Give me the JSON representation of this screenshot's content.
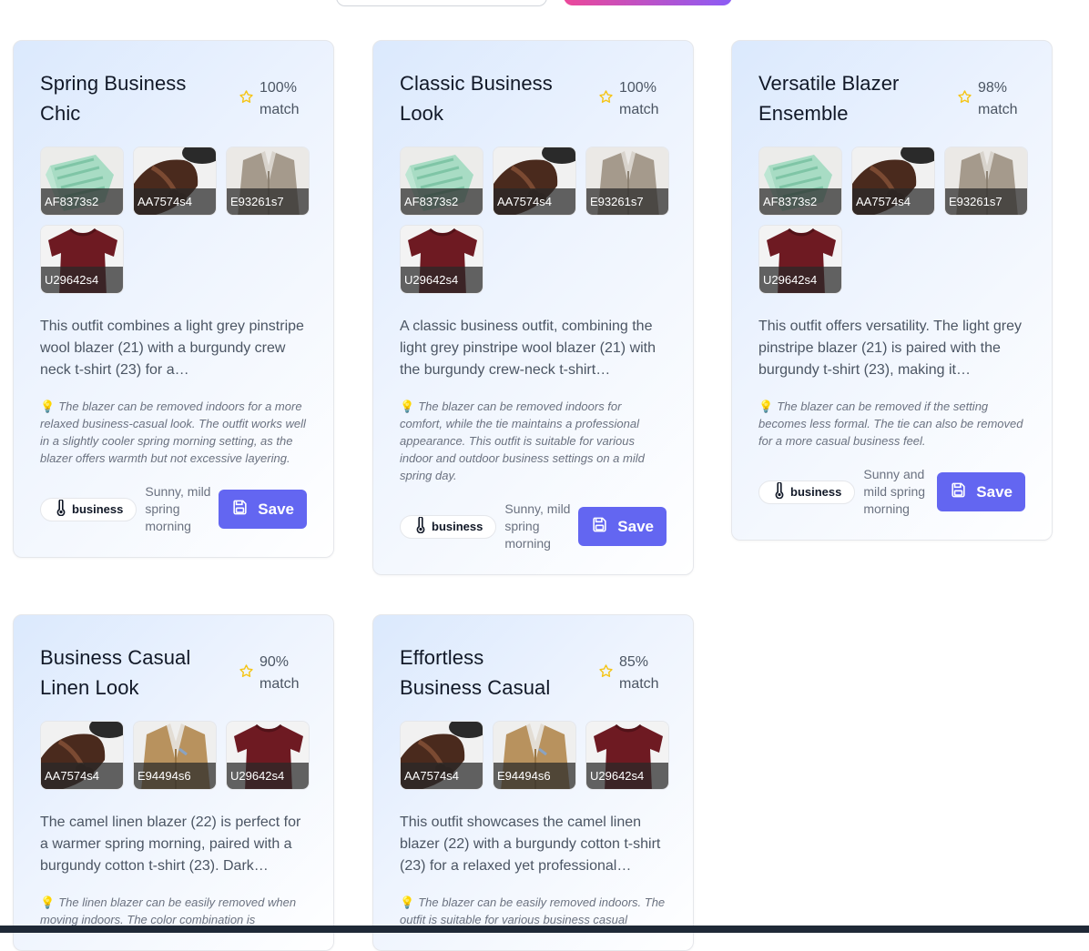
{
  "cards": [
    {
      "title": "Spring Business Chic",
      "match": "100% match",
      "items": [
        {
          "code": "AF8373s2",
          "kind": "green-shirt"
        },
        {
          "code": "AA7574s4",
          "kind": "brown-shoe"
        },
        {
          "code": "E93261s7",
          "kind": "grey-blazer"
        },
        {
          "code": "U29642s4",
          "kind": "burgundy-tshirt"
        }
      ],
      "description": "This outfit combines a light grey pinstripe wool blazer (21) with a burgundy crew neck t-shirt (23) for a…",
      "tip": "The blazer can be removed indoors for a more relaxed business-casual look. The outfit works well in a slightly cooler spring morning setting, as the blazer offers warmth but not excessive layering.",
      "tag": "business",
      "weather": "Sunny, mild spring morning",
      "save_label": "Save"
    },
    {
      "title": "Classic Business Look",
      "match": "100% match",
      "items": [
        {
          "code": "AF8373s2",
          "kind": "green-shirt"
        },
        {
          "code": "AA7574s4",
          "kind": "brown-shoe"
        },
        {
          "code": "E93261s7",
          "kind": "grey-blazer"
        },
        {
          "code": "U29642s4",
          "kind": "burgundy-tshirt"
        }
      ],
      "description": "A classic business outfit, combining the light grey pinstripe wool blazer (21) with the burgundy crew-neck t-shirt…",
      "tip": "The blazer can be removed indoors for comfort, while the tie maintains a professional appearance. This outfit is suitable for various indoor and outdoor business settings on a mild spring day.",
      "tag": "business",
      "weather": "Sunny, mild spring morning",
      "save_label": "Save"
    },
    {
      "title": "Versatile Blazer Ensemble",
      "match": "98% match",
      "items": [
        {
          "code": "AF8373s2",
          "kind": "green-shirt"
        },
        {
          "code": "AA7574s4",
          "kind": "brown-shoe"
        },
        {
          "code": "E93261s7",
          "kind": "grey-blazer"
        },
        {
          "code": "U29642s4",
          "kind": "burgundy-tshirt"
        }
      ],
      "description": "This outfit offers versatility. The light grey pinstripe blazer (21) is paired with the burgundy t-shirt (23), making it…",
      "tip": "The blazer can be removed if the setting becomes less formal. The tie can also be removed for a more casual business feel.",
      "tag": "business",
      "weather": "Sunny and mild spring morning",
      "save_label": "Save"
    },
    {
      "title": "Business Casual Linen Look",
      "match": "90% match",
      "items": [
        {
          "code": "AA7574s4",
          "kind": "brown-shoe"
        },
        {
          "code": "E94494s6",
          "kind": "camel-blazer"
        },
        {
          "code": "U29642s4",
          "kind": "burgundy-tshirt"
        }
      ],
      "description": "The camel linen blazer (22) is perfect for a warmer spring morning, paired with a burgundy cotton t-shirt (23). Dark…",
      "tip": "The linen blazer can be easily removed when moving indoors. The color combination is",
      "tag": "business",
      "weather": "",
      "save_label": "Save"
    },
    {
      "title": "Effortless Business Casual",
      "match": "85% match",
      "items": [
        {
          "code": "AA7574s4",
          "kind": "brown-shoe"
        },
        {
          "code": "E94494s6",
          "kind": "camel-blazer"
        },
        {
          "code": "U29642s4",
          "kind": "burgundy-tshirt"
        }
      ],
      "description": "This outfit showcases the camel linen blazer (22) with a burgundy cotton t-shirt (23) for a relaxed yet professional…",
      "tip": "The blazer can be easily removed indoors. The outfit is suitable for various business casual",
      "tag": "business",
      "weather": "",
      "save_label": "Save"
    }
  ],
  "colors": {
    "accent": "#6366f1",
    "star": "#f5c518",
    "top_gradient_start": "#ec4899",
    "top_gradient_end": "#8b5cf6"
  }
}
